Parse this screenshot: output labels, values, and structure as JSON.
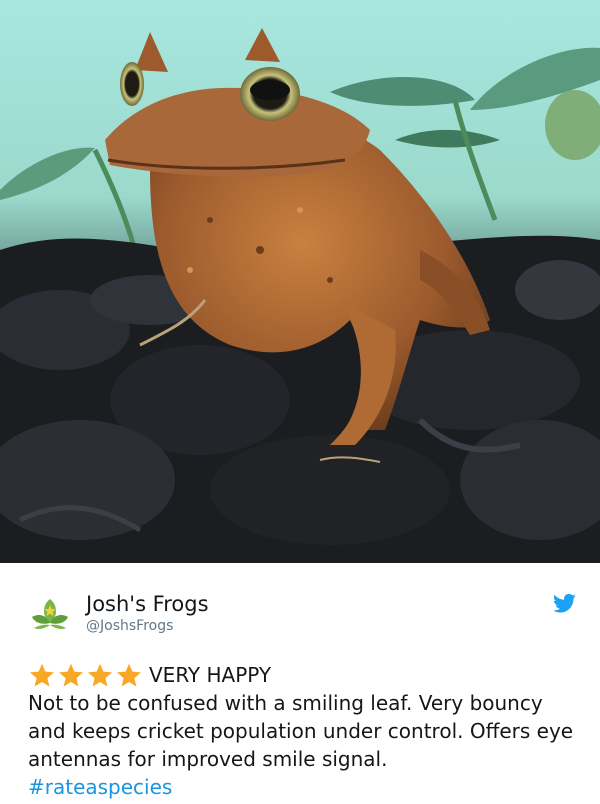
{
  "tweet": {
    "display_name": "Josh's Frogs",
    "handle": "@JoshsFrogs",
    "rating_label": "VERY HAPPY",
    "star_count": 4,
    "body": "Not to be confused with a smiling leaf. Very bouncy and keeps cricket population under control. Offers eye antennas for improved smile signal.",
    "hashtag": "#rateaspecies"
  },
  "icons": {
    "avatar": "leaf-logo-icon",
    "brand": "twitter-bird-icon",
    "rating": "star-icon"
  },
  "colors": {
    "star": "#f9a825",
    "hashtag": "#1b95e0",
    "twitter_blue": "#1da1f2",
    "handle": "#657786"
  }
}
